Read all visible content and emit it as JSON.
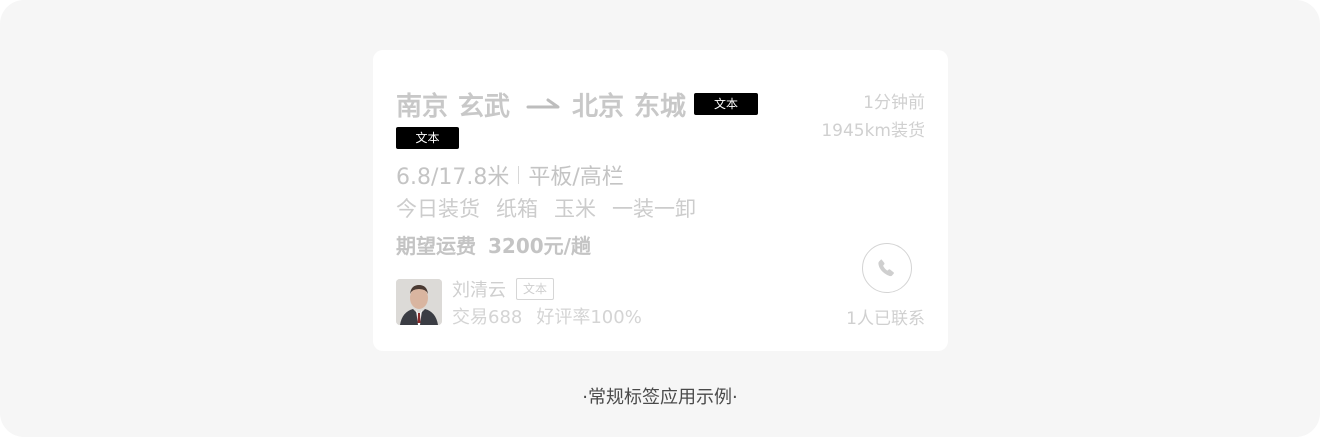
{
  "card": {
    "origin_city": "南京",
    "origin_district": "玄武",
    "destination_city": "北京",
    "destination_district": "东城",
    "tag_inline": "文本",
    "tag_second_row": "文本",
    "posted_time": "1分钟前",
    "distance": "1945km装货",
    "truck_length": "6.8/17.8米",
    "truck_type": "平板/高栏",
    "goods": [
      "今日装货",
      "纸箱",
      "玉米",
      "一装一卸"
    ],
    "price_label": "期望运费",
    "price_value": "3200元/趟",
    "user": {
      "name": "刘清云",
      "tag": "文本",
      "trades": "交易688",
      "rating": "好评率100%"
    },
    "contacted": "1人已联系"
  },
  "caption": "·常规标签应用示例·",
  "colors": {
    "background": "#f6f6f6",
    "card": "#ffffff",
    "tag_black": "#000000",
    "muted_text": "#c8c8c8",
    "caption_text": "#4a4a4a"
  },
  "icons": {
    "route_arrow": "arrow-right-icon",
    "phone": "phone-icon"
  }
}
